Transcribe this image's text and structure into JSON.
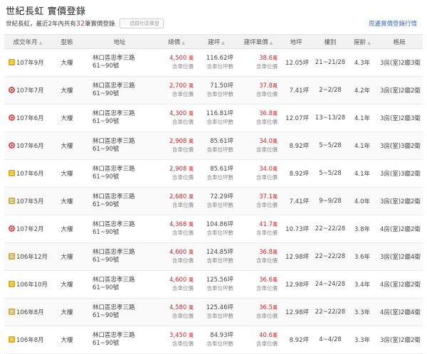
{
  "header": {
    "title": "世紀長虹 實價登錄",
    "summary_prefix": "世紀長虹，最近2年內共有",
    "summary_count": "32",
    "summary_suffix": "筆實價登錄",
    "favorite_label": "追蹤社區實登",
    "more_link": "周邊實價登錄行情"
  },
  "columns": [
    "成交年月",
    "型態",
    "地址",
    "總價",
    "建坪",
    "建坪單價",
    "地坪",
    "樓別",
    "屋齡",
    "格局"
  ],
  "unit_wan": "萬",
  "rows": [
    {
      "icon": "building-icon",
      "date": "107年9月",
      "type": "大樓",
      "addr1": "林口區忠孝三路",
      "addr2": "61~90號",
      "price": "4,500",
      "price_note": "含車位價",
      "area": "116.62坪",
      "area_note": "含車位坪數",
      "unit": "38.6",
      "unit_note": "含車位價",
      "land": "12.05坪",
      "floor": "21~21/28",
      "age": "4.3年",
      "layout": "3房(室)2廳3衛"
    },
    {
      "icon": "pin-icon",
      "date": "107年7月",
      "type": "大樓",
      "addr1": "林口區忠孝三路",
      "addr2": "61~90號",
      "price": "2,700",
      "price_note": "含車位價",
      "area": "71.50坪",
      "area_note": "含車位坪數",
      "unit": "37.8",
      "unit_note": "含車位價",
      "land": "7.41坪",
      "floor": "2~2/28",
      "age": "4.2年",
      "layout": "3房(室)2廳2衛"
    },
    {
      "icon": "pin-icon",
      "date": "107年6月",
      "type": "大樓",
      "addr1": "林口區忠孝三路",
      "addr2": "61~90號",
      "price": "4,300",
      "price_note": "含車位價",
      "area": "116.81坪",
      "area_note": "含車位坪數",
      "unit": "36.8",
      "unit_note": "含車位價",
      "land": "12.07坪",
      "floor": "13~13/28",
      "age": "4.1年",
      "layout": "3房(室)2廳3衛"
    },
    {
      "icon": "pin-icon",
      "date": "107年6月",
      "type": "大樓",
      "addr1": "林口區忠孝三路",
      "addr2": "61~90號",
      "price": "2,908",
      "price_note": "含車位價",
      "area": "85.61坪",
      "area_note": "含車位坪數",
      "unit": "34.0",
      "unit_note": "含車位價",
      "land": "8.92坪",
      "floor": "5~5/28",
      "age": "4.1年",
      "layout": "3房(室)3廳2衛"
    },
    {
      "icon": "building-icon",
      "date": "107年6月",
      "type": "大樓",
      "addr1": "林口區忠孝三路",
      "addr2": "61~90號",
      "price": "2,908",
      "price_note": "含車位價",
      "area": "85.61坪",
      "area_note": "含車位坪數",
      "unit": "34.0",
      "unit_note": "含車位價",
      "land": "8.92坪",
      "floor": "5~5/28",
      "age": "4.1年",
      "layout": "3房(室)3廳2衛"
    },
    {
      "icon": "building-icon",
      "date": "107年5月",
      "type": "大樓",
      "addr1": "林口區忠孝三路",
      "addr2": "61~90號",
      "price": "2,680",
      "price_note": "含車位價",
      "area": "72.29坪",
      "area_note": "含車位坪數",
      "unit": "37.1",
      "unit_note": "含車位價",
      "land": "7.41坪",
      "floor": "9~9/28",
      "age": "4.0年",
      "layout": "3房(室)2廳2衛"
    },
    {
      "icon": "pin-icon",
      "date": "107年2月",
      "type": "大樓",
      "addr1": "林口區忠孝三路",
      "addr2": "61~90號",
      "price": "4,368",
      "price_note": "含車位價",
      "area": "104.86坪",
      "area_note": "含車位坪數",
      "unit": "41.7",
      "unit_note": "含車位價",
      "land": "10.73坪",
      "floor": "22~22/28",
      "age": "3.8年",
      "layout": "4房(室)2廳2衛"
    },
    {
      "icon": "building-icon",
      "date": "106年12月",
      "type": "大樓",
      "addr1": "林口區忠孝三路",
      "addr2": "61~90號",
      "price": "4,600",
      "price_note": "含車位價",
      "area": "124.85坪",
      "area_note": "含車位坪數",
      "unit": "36.8",
      "unit_note": "含車位價",
      "land": "12.98坪",
      "floor": "22~22/28",
      "age": "3.6年",
      "layout": "3房(室)2廳4衛"
    },
    {
      "icon": "building-icon",
      "date": "106年10月",
      "type": "大樓",
      "addr1": "林口區忠孝三路",
      "addr2": "61~90號",
      "price": "4,600",
      "price_note": "含車位價",
      "area": "125.56坪",
      "area_note": "含車位坪數",
      "unit": "36.6",
      "unit_note": "含車位價",
      "land": "12.98坪",
      "floor": "24~24/28",
      "age": "3.4年",
      "layout": "4房(室)2廳2衛"
    },
    {
      "icon": "building-icon",
      "date": "106年8月",
      "type": "大樓",
      "addr1": "林口區忠孝三路",
      "addr2": "61~90號",
      "price": "4,580",
      "price_note": "含車位價",
      "area": "125.46坪",
      "area_note": "含車位坪數",
      "unit": "36.5",
      "unit_note": "含車位價",
      "land": "12.98坪",
      "floor": "22~22/28",
      "age": "3.3年",
      "layout": "4房(室)2廳4衛"
    },
    {
      "icon": "building-icon",
      "date": "106年8月",
      "type": "大樓",
      "addr1": "林口區忠孝三路",
      "addr2": "61~90號",
      "price": "3,450",
      "price_note": "含車位價",
      "area": "84.93坪",
      "area_note": "含車位坪數",
      "unit": "40.6",
      "unit_note": "含車位價",
      "land": "8.92坪",
      "floor": "4~4/28",
      "age": "3.3年",
      "layout": "3房(室)2廳2衛"
    }
  ]
}
